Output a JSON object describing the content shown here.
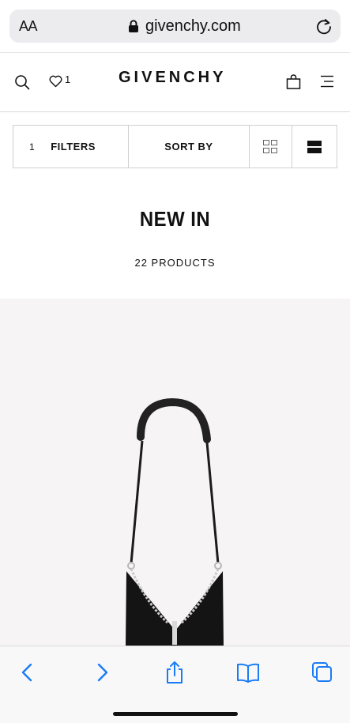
{
  "browser": {
    "text_size_label": "AA",
    "domain": "givenchy.com"
  },
  "header": {
    "brand": "GIVENCHY",
    "wishlist_count": "1"
  },
  "filters_bar": {
    "active_filter_count": "1",
    "filters_label": "FILTERS",
    "sort_label": "SORT BY"
  },
  "listing": {
    "title": "NEW IN",
    "product_count": "22 PRODUCTS"
  },
  "colors": {
    "accent_blue": "#1a7cf5",
    "product_bg": "#f6f4f5"
  },
  "icons": {
    "url_lock": "lock-icon",
    "reload": "reload-icon",
    "search": "search-icon",
    "wishlist": "heart-icon",
    "bag": "shopping-bag-icon",
    "menu": "menu-icon",
    "grid_view": "grid-view-icon",
    "list_view": "list-view-icon",
    "back": "back-arrow-icon",
    "forward": "forward-arrow-icon",
    "share": "share-icon",
    "bookmarks": "bookmarks-icon",
    "tabs": "tabs-icon"
  }
}
